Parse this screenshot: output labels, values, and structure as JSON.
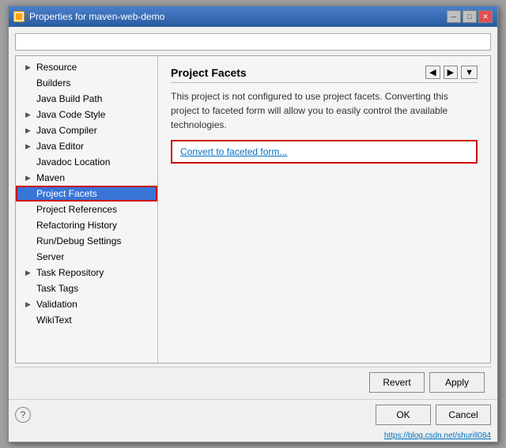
{
  "window": {
    "title": "Properties for maven-web-demo",
    "icon": "P"
  },
  "search": {
    "placeholder": ""
  },
  "nav": {
    "items": [
      {
        "label": "Resource",
        "hasArrow": true,
        "id": "resource"
      },
      {
        "label": "Builders",
        "hasArrow": false,
        "id": "builders"
      },
      {
        "label": "Java Build Path",
        "hasArrow": false,
        "id": "java-build-path"
      },
      {
        "label": "Java Code Style",
        "hasArrow": true,
        "id": "java-code-style"
      },
      {
        "label": "Java Compiler",
        "hasArrow": true,
        "id": "java-compiler"
      },
      {
        "label": "Java Editor",
        "hasArrow": true,
        "id": "java-editor"
      },
      {
        "label": "Javadoc Location",
        "hasArrow": false,
        "id": "javadoc-location"
      },
      {
        "label": "Maven",
        "hasArrow": true,
        "id": "maven"
      },
      {
        "label": "Project Facets",
        "hasArrow": false,
        "id": "project-facets",
        "selected": true,
        "highlighted": true
      },
      {
        "label": "Project References",
        "hasArrow": false,
        "id": "project-references"
      },
      {
        "label": "Refactoring History",
        "hasArrow": false,
        "id": "refactoring-history"
      },
      {
        "label": "Run/Debug Settings",
        "hasArrow": false,
        "id": "run-debug-settings"
      },
      {
        "label": "Server",
        "hasArrow": false,
        "id": "server"
      },
      {
        "label": "Task Repository",
        "hasArrow": true,
        "id": "task-repository"
      },
      {
        "label": "Task Tags",
        "hasArrow": false,
        "id": "task-tags"
      },
      {
        "label": "Validation",
        "hasArrow": true,
        "id": "validation"
      },
      {
        "label": "WikiText",
        "hasArrow": false,
        "id": "wikitext"
      }
    ]
  },
  "panel": {
    "title": "Project Facets",
    "description": "This project is not configured to use project facets. Converting this project to faceted form will allow you to easily control the available technologies.",
    "convert_link": "Convert to faceted form...",
    "toolbar": {
      "back": "◀",
      "forward": "▶",
      "menu": "▼"
    }
  },
  "buttons": {
    "revert": "Revert",
    "apply": "Apply",
    "ok": "OK",
    "cancel": "Cancel",
    "help": "?"
  },
  "status": {
    "url": "https://blog.csdn.net/shurill084"
  }
}
